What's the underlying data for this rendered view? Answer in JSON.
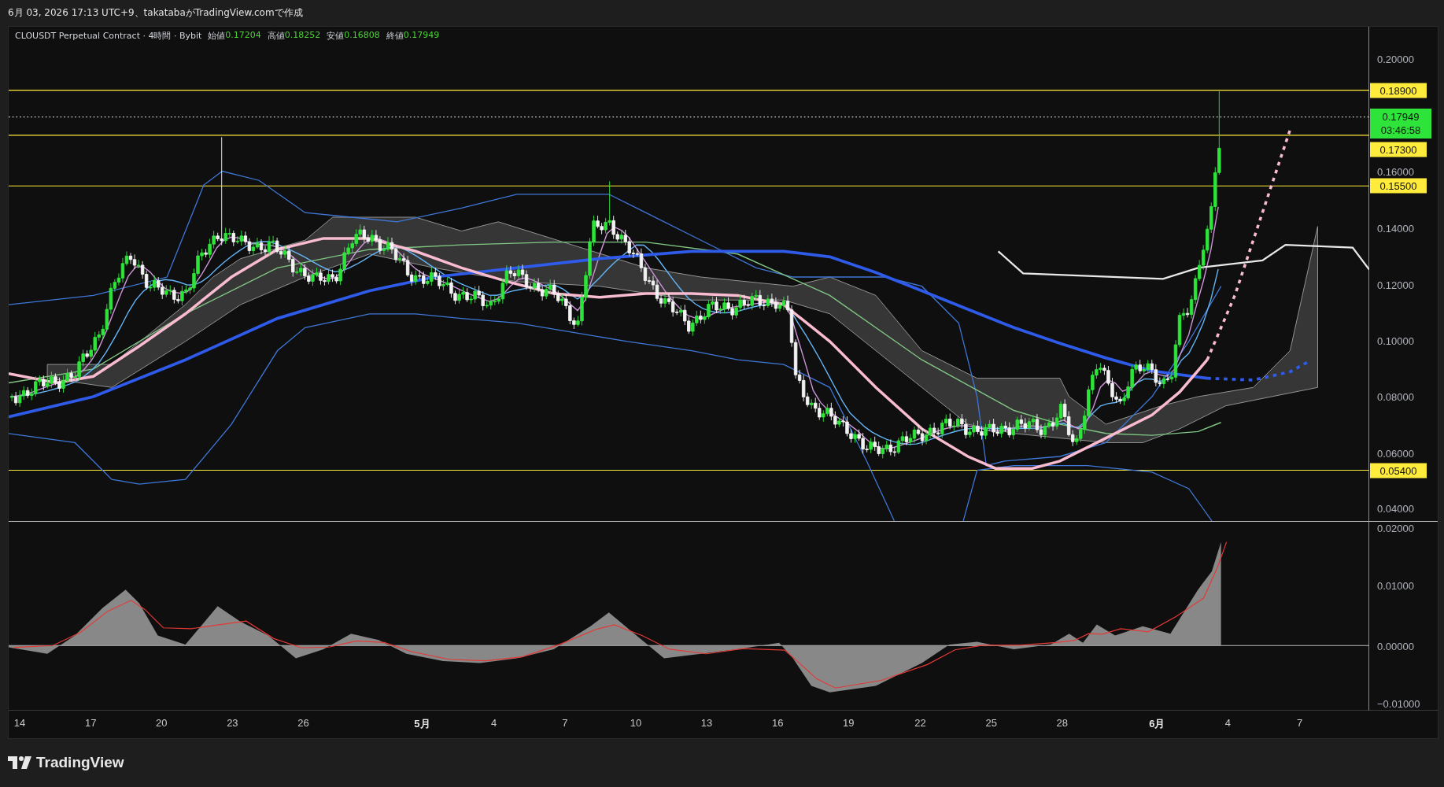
{
  "caption": "6月 03, 2026 17:13 UTC+9、takatabaがTradingView.comで作成",
  "legend": {
    "symbol": "CLOUSDT Perpetual Contract · 4時間 · Bybit",
    "values": [
      {
        "label": "始値",
        "value": "0.17204"
      },
      {
        "label": "高値",
        "value": "0.18252"
      },
      {
        "label": "安値",
        "value": "0.16808"
      },
      {
        "label": "終値",
        "value": "0.17949"
      }
    ]
  },
  "price_axis": {
    "labels": [
      "0.20000",
      "0.16000",
      "0.14000",
      "0.12000",
      "0.10000",
      "0.08000",
      "0.06000",
      "0.04000"
    ]
  },
  "levels": [
    {
      "price": "0.18900"
    },
    {
      "price": "0.17300"
    },
    {
      "price": "0.15500"
    },
    {
      "price": "0.05400"
    }
  ],
  "last_price": {
    "price": "0.17949",
    "countdown": "03:46:58"
  },
  "oscillator_axis": {
    "labels": [
      "0.02000",
      "0.01000",
      "0.00000",
      "−0.01000"
    ]
  },
  "time_axis": {
    "labels": [
      {
        "text": "14",
        "kind": "day"
      },
      {
        "text": "17",
        "kind": "day"
      },
      {
        "text": "20",
        "kind": "day"
      },
      {
        "text": "23",
        "kind": "day"
      },
      {
        "text": "26",
        "kind": "day"
      },
      {
        "text": "5月",
        "kind": "month"
      },
      {
        "text": "4",
        "kind": "day"
      },
      {
        "text": "7",
        "kind": "day"
      },
      {
        "text": "10",
        "kind": "day"
      },
      {
        "text": "13",
        "kind": "day"
      },
      {
        "text": "16",
        "kind": "day"
      },
      {
        "text": "19",
        "kind": "day"
      },
      {
        "text": "22",
        "kind": "day"
      },
      {
        "text": "25",
        "kind": "day"
      },
      {
        "text": "28",
        "kind": "day"
      },
      {
        "text": "6月",
        "kind": "month"
      },
      {
        "text": "4",
        "kind": "day"
      },
      {
        "text": "7",
        "kind": "day"
      }
    ]
  },
  "logo": "TradingView"
}
